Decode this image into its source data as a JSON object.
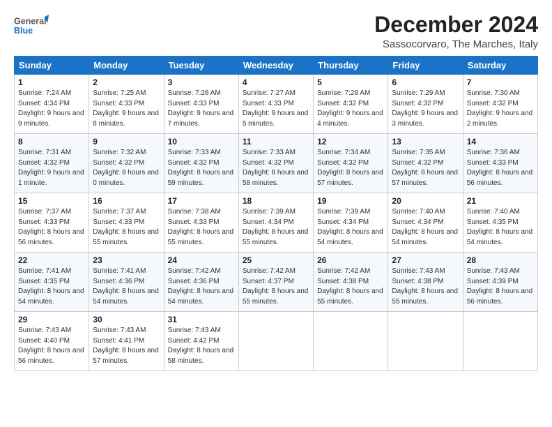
{
  "logo": {
    "line1": "General",
    "line2": "Blue"
  },
  "title": "December 2024",
  "location": "Sassocorvaro, The Marches, Italy",
  "days_of_week": [
    "Sunday",
    "Monday",
    "Tuesday",
    "Wednesday",
    "Thursday",
    "Friday",
    "Saturday"
  ],
  "weeks": [
    [
      {
        "day": "1",
        "info": "Sunrise: 7:24 AM\nSunset: 4:34 PM\nDaylight: 9 hours and 9 minutes."
      },
      {
        "day": "2",
        "info": "Sunrise: 7:25 AM\nSunset: 4:33 PM\nDaylight: 9 hours and 8 minutes."
      },
      {
        "day": "3",
        "info": "Sunrise: 7:26 AM\nSunset: 4:33 PM\nDaylight: 9 hours and 7 minutes."
      },
      {
        "day": "4",
        "info": "Sunrise: 7:27 AM\nSunset: 4:33 PM\nDaylight: 9 hours and 5 minutes."
      },
      {
        "day": "5",
        "info": "Sunrise: 7:28 AM\nSunset: 4:32 PM\nDaylight: 9 hours and 4 minutes."
      },
      {
        "day": "6",
        "info": "Sunrise: 7:29 AM\nSunset: 4:32 PM\nDaylight: 9 hours and 3 minutes."
      },
      {
        "day": "7",
        "info": "Sunrise: 7:30 AM\nSunset: 4:32 PM\nDaylight: 9 hours and 2 minutes."
      }
    ],
    [
      {
        "day": "8",
        "info": "Sunrise: 7:31 AM\nSunset: 4:32 PM\nDaylight: 9 hours and 1 minute."
      },
      {
        "day": "9",
        "info": "Sunrise: 7:32 AM\nSunset: 4:32 PM\nDaylight: 9 hours and 0 minutes."
      },
      {
        "day": "10",
        "info": "Sunrise: 7:33 AM\nSunset: 4:32 PM\nDaylight: 8 hours and 59 minutes."
      },
      {
        "day": "11",
        "info": "Sunrise: 7:33 AM\nSunset: 4:32 PM\nDaylight: 8 hours and 58 minutes."
      },
      {
        "day": "12",
        "info": "Sunrise: 7:34 AM\nSunset: 4:32 PM\nDaylight: 8 hours and 57 minutes."
      },
      {
        "day": "13",
        "info": "Sunrise: 7:35 AM\nSunset: 4:32 PM\nDaylight: 8 hours and 57 minutes."
      },
      {
        "day": "14",
        "info": "Sunrise: 7:36 AM\nSunset: 4:33 PM\nDaylight: 8 hours and 56 minutes."
      }
    ],
    [
      {
        "day": "15",
        "info": "Sunrise: 7:37 AM\nSunset: 4:33 PM\nDaylight: 8 hours and 56 minutes."
      },
      {
        "day": "16",
        "info": "Sunrise: 7:37 AM\nSunset: 4:33 PM\nDaylight: 8 hours and 55 minutes."
      },
      {
        "day": "17",
        "info": "Sunrise: 7:38 AM\nSunset: 4:33 PM\nDaylight: 8 hours and 55 minutes."
      },
      {
        "day": "18",
        "info": "Sunrise: 7:39 AM\nSunset: 4:34 PM\nDaylight: 8 hours and 55 minutes."
      },
      {
        "day": "19",
        "info": "Sunrise: 7:39 AM\nSunset: 4:34 PM\nDaylight: 8 hours and 54 minutes."
      },
      {
        "day": "20",
        "info": "Sunrise: 7:40 AM\nSunset: 4:34 PM\nDaylight: 8 hours and 54 minutes."
      },
      {
        "day": "21",
        "info": "Sunrise: 7:40 AM\nSunset: 4:35 PM\nDaylight: 8 hours and 54 minutes."
      }
    ],
    [
      {
        "day": "22",
        "info": "Sunrise: 7:41 AM\nSunset: 4:35 PM\nDaylight: 8 hours and 54 minutes."
      },
      {
        "day": "23",
        "info": "Sunrise: 7:41 AM\nSunset: 4:36 PM\nDaylight: 8 hours and 54 minutes."
      },
      {
        "day": "24",
        "info": "Sunrise: 7:42 AM\nSunset: 4:36 PM\nDaylight: 8 hours and 54 minutes."
      },
      {
        "day": "25",
        "info": "Sunrise: 7:42 AM\nSunset: 4:37 PM\nDaylight: 8 hours and 55 minutes."
      },
      {
        "day": "26",
        "info": "Sunrise: 7:42 AM\nSunset: 4:38 PM\nDaylight: 8 hours and 55 minutes."
      },
      {
        "day": "27",
        "info": "Sunrise: 7:43 AM\nSunset: 4:38 PM\nDaylight: 8 hours and 55 minutes."
      },
      {
        "day": "28",
        "info": "Sunrise: 7:43 AM\nSunset: 4:39 PM\nDaylight: 8 hours and 56 minutes."
      }
    ],
    [
      {
        "day": "29",
        "info": "Sunrise: 7:43 AM\nSunset: 4:40 PM\nDaylight: 8 hours and 56 minutes."
      },
      {
        "day": "30",
        "info": "Sunrise: 7:43 AM\nSunset: 4:41 PM\nDaylight: 8 hours and 57 minutes."
      },
      {
        "day": "31",
        "info": "Sunrise: 7:43 AM\nSunset: 4:42 PM\nDaylight: 8 hours and 58 minutes."
      },
      {
        "day": "",
        "info": ""
      },
      {
        "day": "",
        "info": ""
      },
      {
        "day": "",
        "info": ""
      },
      {
        "day": "",
        "info": ""
      }
    ]
  ]
}
